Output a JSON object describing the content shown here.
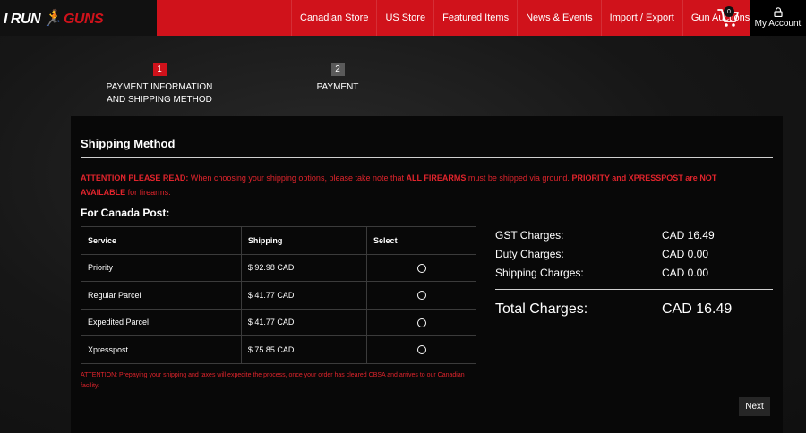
{
  "brand": {
    "logo_left": "I RUN",
    "logo_right": "GUNS",
    "accent_color": "#d0121b"
  },
  "nav": {
    "items": [
      "Canadian Store",
      "US Store",
      "Featured Items",
      "News & Events",
      "Import / Export",
      "Gun Auctions"
    ],
    "cart_count": "0",
    "account_label": "My Account"
  },
  "steps": [
    {
      "number": "1",
      "label_line1": "PAYMENT INFORMATION",
      "label_line2": "AND SHIPPING METHOD",
      "active": true
    },
    {
      "number": "2",
      "label_line1": "PAYMENT",
      "label_line2": "",
      "active": false
    }
  ],
  "shipping": {
    "title": "Shipping Method",
    "attention_prefix": "ATTENTION PLEASE READ:",
    "attention_text1": " When choosing your shipping options, please take note that ",
    "attention_bold1": "ALL FIREARMS",
    "attention_text2": " must be shipped via ground. ",
    "attention_bold2": "PRIORITY and XPRESSPOST are NOT AVAILABLE",
    "attention_text3": " for firearms.",
    "carrier_title": "For Canada Post:",
    "columns": [
      "Service",
      "Shipping",
      "Select"
    ],
    "rows": [
      {
        "service": "Priority",
        "price": "$ 92.98 CAD"
      },
      {
        "service": "Regular Parcel",
        "price": "$ 41.77 CAD"
      },
      {
        "service": "Expedited Parcel",
        "price": "$ 41.77 CAD"
      },
      {
        "service": "Xpresspost",
        "price": "$ 75.85 CAD"
      }
    ],
    "note": "ATTENTION: Prepaying your shipping and taxes will expedite the process, once your order has cleared CBSA and arrives to our Canadian facility."
  },
  "summary": {
    "gst_label": "GST Charges:",
    "gst_value": "CAD 16.49",
    "duty_label": "Duty Charges:",
    "duty_value": "CAD 0.00",
    "shipping_label": "Shipping Charges:",
    "shipping_value": "CAD 0.00",
    "total_label": "Total Charges:",
    "total_value": "CAD 16.49"
  },
  "actions": {
    "next_label": "Next"
  }
}
